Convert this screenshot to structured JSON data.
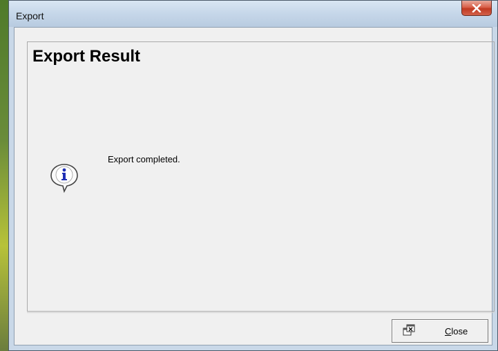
{
  "window": {
    "title": "Export",
    "close_icon": "close-x-icon"
  },
  "group": {
    "title": "Export Result"
  },
  "message": {
    "icon": "info-balloon-icon",
    "text": "Export completed."
  },
  "buttons": {
    "close": {
      "icon": "window-close-icon",
      "mnemonic": "C",
      "label_rest": "lose"
    }
  },
  "colors": {
    "close_button_red": "#c13a22",
    "dialog_background": "#f0f0f0",
    "titlebar": "#c7d8ea",
    "info_icon_blue": "#1f2fb5"
  }
}
